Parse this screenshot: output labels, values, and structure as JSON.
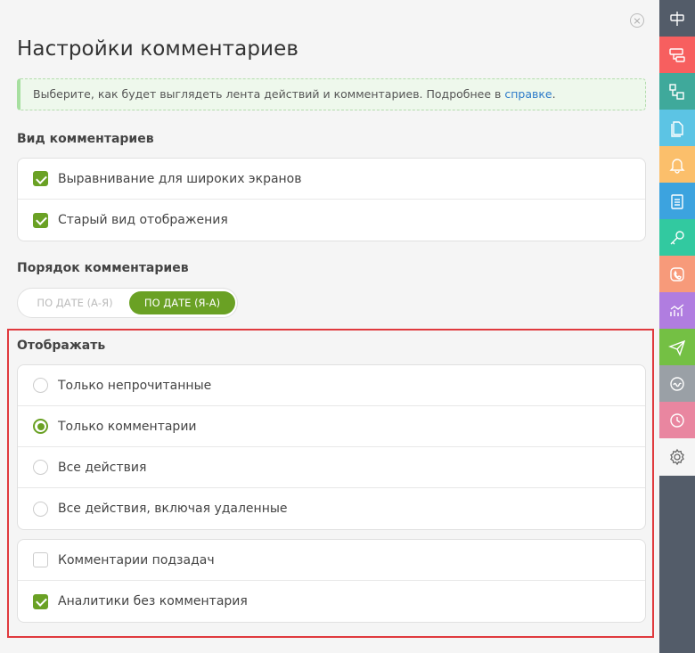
{
  "title": "Настройки комментариев",
  "info": {
    "text": "Выберите, как будет выглядеть лента действий и комментариев. Подробнее в ",
    "link": "справке",
    "suffix": "."
  },
  "view_section": {
    "title": "Вид комментариев",
    "items": [
      {
        "label": "Выравнивание для широких экранов",
        "checked": true
      },
      {
        "label": "Старый вид отображения",
        "checked": true
      }
    ]
  },
  "order_section": {
    "title": "Порядок комментариев",
    "options": [
      "ПО ДАТЕ (А-Я)",
      "ПО ДАТЕ (Я-А)"
    ],
    "selected": "ПО ДАТЕ (Я-А)"
  },
  "display_section": {
    "title": "Отображать",
    "radio_items": [
      {
        "label": "Только непрочитанные",
        "selected": false
      },
      {
        "label": "Только комментарии",
        "selected": true
      },
      {
        "label": "Все действия",
        "selected": false
      },
      {
        "label": "Все действия, включая удаленные",
        "selected": false
      }
    ],
    "check_items": [
      {
        "label": "Комментарии подзадач",
        "checked": false
      },
      {
        "label": "Аналитики без комментария",
        "checked": true
      }
    ]
  },
  "sidebar": {
    "items": [
      {
        "icon": "tree-icon",
        "color": "#535c69"
      },
      {
        "icon": "task-flow-icon",
        "color": "#f75f5f"
      },
      {
        "icon": "structure-icon",
        "color": "#3fa99b"
      },
      {
        "icon": "documents-icon",
        "color": "#5cc4e4"
      },
      {
        "icon": "bell-icon",
        "color": "#fbbf6b"
      },
      {
        "icon": "clipboard-icon",
        "color": "#3ca3df"
      },
      {
        "icon": "key-icon",
        "color": "#32c9a0"
      },
      {
        "icon": "phone-icon",
        "color": "#f79a7a"
      },
      {
        "icon": "analytics-icon",
        "color": "#b07de0"
      },
      {
        "icon": "send-icon",
        "color": "#74c044"
      },
      {
        "icon": "wave-icon",
        "color": "#9aa0a6"
      },
      {
        "icon": "clock-icon",
        "color": "#e986a0"
      },
      {
        "icon": "gear-icon",
        "color": "#f5f5f5"
      }
    ]
  }
}
